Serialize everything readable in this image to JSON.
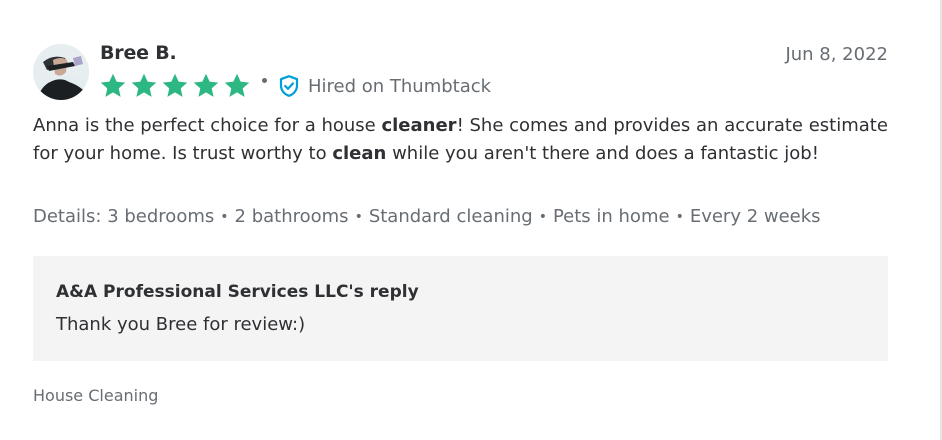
{
  "review": {
    "reviewer_name": "Bree B.",
    "date": "Jun 8, 2022",
    "rating": 5,
    "rating_max": 5,
    "hired_label": "Hired on Thumbtack",
    "body_parts": [
      "Anna is the perfect choice for a house ",
      "cleaner",
      "! She comes and provides an accurate estimate for your home. Is trust worthy to ",
      "clean",
      " while you aren't there and does a fantastic job!"
    ],
    "details_label": "Details:",
    "details": [
      "3 bedrooms",
      "2 bathrooms",
      "Standard cleaning",
      "Pets in home",
      "Every 2 weeks"
    ],
    "details_separator": "•"
  },
  "reply": {
    "title": "A&A Professional Services LLC's reply",
    "text": "Thank you Bree for review:)"
  },
  "category": "House Cleaning",
  "colors": {
    "star": "#2db783",
    "shield": "#009fd9",
    "text_primary": "#2f3033",
    "text_secondary": "#676d73",
    "reply_background": "#f4f4f4"
  },
  "icons": {
    "star": "star-icon",
    "shield": "verified-shield-icon"
  }
}
